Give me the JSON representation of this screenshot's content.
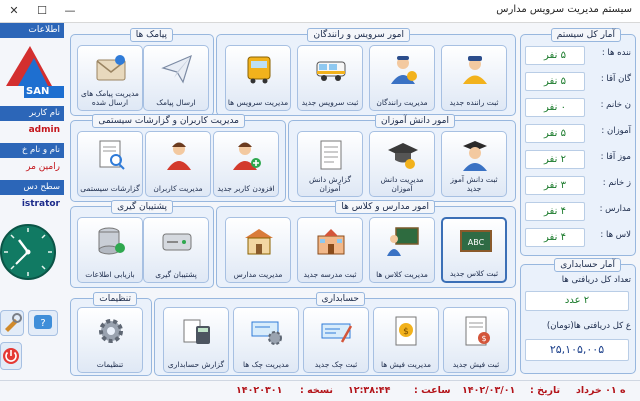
{
  "window": {
    "title": "سیستم مدیریت سرویس مدارس",
    "close": "✕",
    "maximize": "☐",
    "minimize": "—"
  },
  "left": {
    "header": "اطلاعات",
    "logo_text": "SAN",
    "user_label": "نام کاربر",
    "user_value": "admin",
    "fullname_label": "نام و نام خ",
    "fullname_value": "رامین مر",
    "access_label": "سطح دس",
    "access_value": "istrator"
  },
  "panels": {
    "sms": {
      "title": "پیامک ها"
    },
    "services": {
      "title": "امور سرویس و رانندگان"
    },
    "users": {
      "title": "مدیریت کاربران و گزارشات سیستمی"
    },
    "students": {
      "title": "امور دانش آموزان"
    },
    "backup": {
      "title": "پشتیبان گیری"
    },
    "schools": {
      "title": "امور مدارس و کلاس ها"
    },
    "settings": {
      "title": "تنظیمات"
    },
    "accounting": {
      "title": "حسابداری"
    },
    "stats": {
      "title": "آمار کل سیستم"
    },
    "finance": {
      "title": "آمار حسابداری"
    }
  },
  "tiles": {
    "sms_manage": "مدیریت پیامک های ارسال شده",
    "sms_send": "ارسال پیامک",
    "service_manage": "مدیریت سرویس ها",
    "service_new": "ثبت سرویس جدید",
    "driver_manage": "مدیریت رانندگان",
    "driver_new": "ثبت راننده جدید",
    "sys_reports": "گزارشات سیستمی",
    "user_manage": "مدیریت کاربران",
    "user_new": "افزودن کاربر جدید",
    "student_report": "گزارش دانش آموزان",
    "student_manage": "مدیریت دانش آموزان",
    "student_new": "ثبت دانش آموز جدید",
    "restore": "بازیابی اطلاعات",
    "backup": "پشتیبان گیری",
    "school_manage": "مدیریت مدارس",
    "school_new": "ثبت مدرسه جدید",
    "class_manage": "مدیریت کلاس ها",
    "class_new": "ثبت کلاس جدید",
    "settings": "تنظیمات",
    "acc_report": "گزارش حسابداری",
    "check_manage": "مدیریت چک ها",
    "check_new": "ثبت چک جدید",
    "receipt_manage": "مدیریت فیش ها",
    "receipt_new": "ثبت فیش جدید"
  },
  "stats": [
    {
      "label": "ننده ها :",
      "value": "۵ نفر"
    },
    {
      "label": "گان آقا :",
      "value": "۵ نفر"
    },
    {
      "label": "ن خانم :",
      "value": "۰ نفر"
    },
    {
      "label": "آموزان :",
      "value": "۵ نفر"
    },
    {
      "label": "موز آقا :",
      "value": "۲ نفر"
    },
    {
      "label": "ز خانم :",
      "value": "۳ نفر"
    },
    {
      "label": "مدارس :",
      "value": "۴ نفر"
    },
    {
      "label": "لاس ها :",
      "value": "۴ نفر"
    }
  ],
  "finance": {
    "count_label": "تعداد کل دریافتی ها",
    "count_value": "۲ عدد",
    "sum_label": "ع کل دریافتی ها(تومان)",
    "sum_value": "۲۵,۱۰۵,۰۰۵"
  },
  "status": {
    "version_label": "نسخه :",
    "version_value": "۱۴۰۲۰۳۰۱",
    "time_label": "ساعت :",
    "time_value": "۱۲:۳۸:۴۴",
    "date_label": "تاریخ :",
    "date_value": "۱۴۰۲/۰۳/۰۱",
    "day_text": "ه ۰۱ خرداد"
  }
}
